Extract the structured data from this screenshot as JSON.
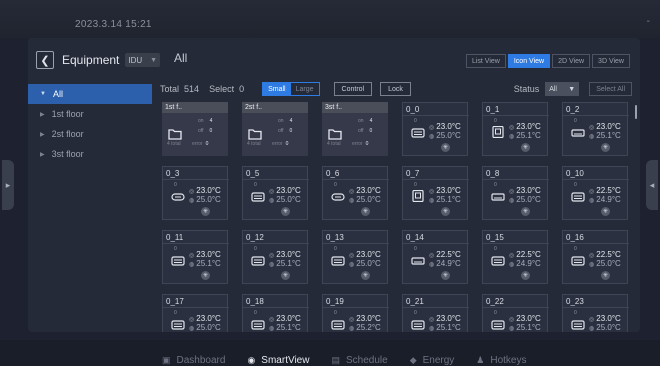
{
  "status_bar": {
    "datetime": "2023.3.14   15:21",
    "dash": "-"
  },
  "header": {
    "title": "Equipment",
    "filter": "IDU",
    "crumb": "All"
  },
  "view_tabs": [
    "List View",
    "Icon View",
    "2D View",
    "3D View"
  ],
  "active_view": "Icon View",
  "tree": [
    {
      "label": "All",
      "selected": true
    },
    {
      "label": "1st floor",
      "selected": false
    },
    {
      "label": "2st floor",
      "selected": false
    },
    {
      "label": "3st floor",
      "selected": false
    }
  ],
  "toolbar": {
    "total_label": "Total",
    "total_value": "514",
    "select_label": "Select",
    "select_value": "0",
    "size_small": "Small",
    "size_large": "Large",
    "control": "Control",
    "lock": "Lock",
    "status_label": "Status",
    "status_value": "All",
    "select_all": "Select All"
  },
  "groups": [
    {
      "name": "1st f..",
      "on_label": "on",
      "on_value": "4",
      "off_label": "off",
      "off_value": "0",
      "total": "4 total",
      "error_label": "error",
      "error_value": "0"
    },
    {
      "name": "2st f..",
      "on_label": "on",
      "on_value": "4",
      "off_label": "off",
      "off_value": "0",
      "total": "4 total",
      "error_label": "error",
      "error_value": "0"
    },
    {
      "name": "3st f..",
      "on_label": "on",
      "on_value": "4",
      "off_label": "off",
      "off_value": "0",
      "total": "4 total",
      "error_label": "error",
      "error_value": "0"
    }
  ],
  "units": [
    {
      "name": "0_0",
      "icon": "ac-unit-icon",
      "set": "23.0°C",
      "room": "25.0°C"
    },
    {
      "name": "0_1",
      "icon": "panel-unit-icon",
      "set": "23.0°C",
      "room": "25.1°C"
    },
    {
      "name": "0_2",
      "icon": "wall-unit-icon",
      "set": "23.0°C",
      "room": "25.1°C"
    },
    {
      "name": "0_3",
      "icon": "duct-unit-icon",
      "set": "23.0°C",
      "room": "25.0°C"
    },
    {
      "name": "0_5",
      "icon": "ac-unit-icon",
      "set": "23.0°C",
      "room": "25.0°C"
    },
    {
      "name": "0_6",
      "icon": "duct-unit-icon",
      "set": "23.0°C",
      "room": "25.0°C"
    },
    {
      "name": "0_7",
      "icon": "panel-unit-icon",
      "set": "23.0°C",
      "room": "25.1°C"
    },
    {
      "name": "0_8",
      "icon": "wall-unit-icon",
      "set": "23.0°C",
      "room": "25.0°C"
    },
    {
      "name": "0_10",
      "icon": "ac-unit-icon",
      "set": "22.5°C",
      "room": "24.9°C"
    },
    {
      "name": "0_11",
      "icon": "ac-unit-icon",
      "set": "23.0°C",
      "room": "25.1°C"
    },
    {
      "name": "0_12",
      "icon": "ac-unit-icon",
      "set": "23.0°C",
      "room": "25.1°C"
    },
    {
      "name": "0_13",
      "icon": "ac-unit-icon",
      "set": "23.0°C",
      "room": "25.0°C"
    },
    {
      "name": "0_14",
      "icon": "wall-unit-icon",
      "set": "22.5°C",
      "room": "24.9°C"
    },
    {
      "name": "0_15",
      "icon": "ac-unit-icon",
      "set": "22.5°C",
      "room": "24.9°C"
    },
    {
      "name": "0_16",
      "icon": "ac-unit-icon",
      "set": "22.5°C",
      "room": "25.0°C"
    },
    {
      "name": "0_17",
      "icon": "ac-unit-icon",
      "set": "23.0°C",
      "room": "25.0°C"
    },
    {
      "name": "0_18",
      "icon": "ac-unit-icon",
      "set": "23.0°C",
      "room": "25.1°C"
    },
    {
      "name": "0_19",
      "icon": "ac-unit-icon",
      "set": "23.0°C",
      "room": "25.2°C"
    },
    {
      "name": "0_21",
      "icon": "ac-unit-icon",
      "set": "23.0°C",
      "room": "25.1°C"
    },
    {
      "name": "0_22",
      "icon": "ac-unit-icon",
      "set": "23.0°C",
      "room": "25.1°C"
    },
    {
      "name": "0_23",
      "icon": "ac-unit-icon",
      "set": "23.0°C",
      "room": "25.0°C"
    }
  ],
  "unit_icon_caption": "0",
  "nav": [
    {
      "label": "Dashboard",
      "icon": "dashboard-icon",
      "active": false
    },
    {
      "label": "SmartView",
      "icon": "smartview-icon",
      "active": true
    },
    {
      "label": "Schedule",
      "icon": "schedule-icon",
      "active": false
    },
    {
      "label": "Energy",
      "icon": "energy-icon",
      "active": false
    },
    {
      "label": "Hotkeys",
      "icon": "hotkeys-icon",
      "active": false
    }
  ],
  "colors": {
    "accent": "#2f7be4",
    "panel": "#252a38",
    "background": "#1e2230"
  }
}
